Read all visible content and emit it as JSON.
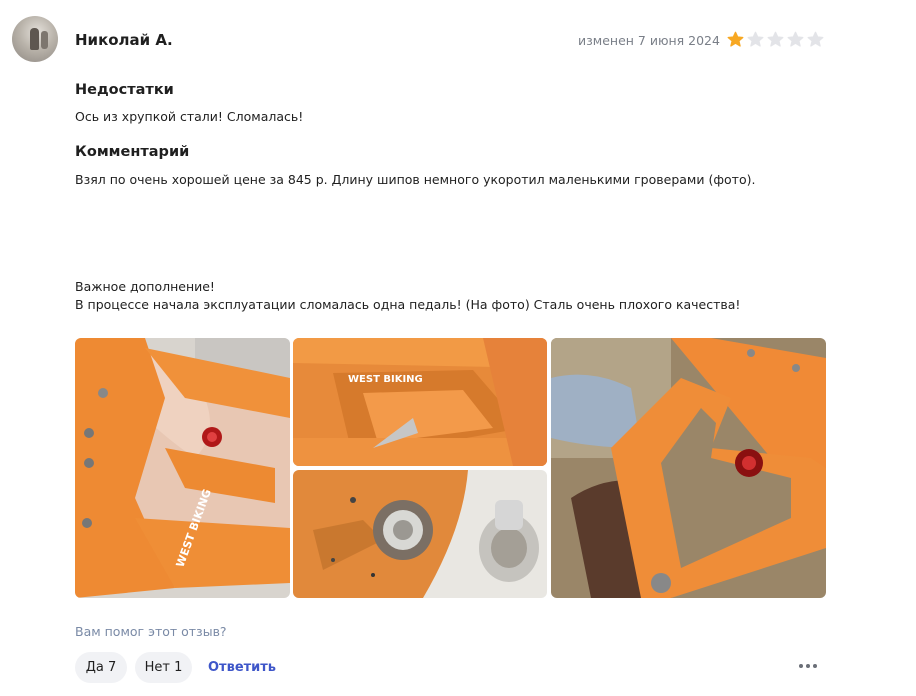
{
  "review": {
    "author": "Николай А.",
    "edited": "изменен 7 июня 2024",
    "rating": 1,
    "rating_max": 5,
    "colors": {
      "star_on": "#f7a823",
      "star_off": "#e3e4e8"
    },
    "cons_title": "Недостатки",
    "cons_text": "Ось из хрупкой стали! Сломалась!",
    "comment_title": "Комментарий",
    "comment_text": "Взял по очень хорошей цене за 845 р. Длину шипов немного укоротил маленькими гроверами (фото).",
    "addition_line1": "Важное дополнение!",
    "addition_line2": "В процессе начала эксплуатации сломалась одна педаль! (На фото) Сталь очень плохого качества!",
    "photos": [
      {
        "name": "pedal-in-hand",
        "label": "WEST BIKING"
      },
      {
        "name": "pedal-closeup-logo",
        "label": "WEST BIKING"
      },
      {
        "name": "broken-axle"
      },
      {
        "name": "pedal-on-table"
      }
    ]
  },
  "footer": {
    "helpful_question": "Вам помог этот отзыв?",
    "yes_label": "Да 7",
    "no_label": "Нет 1",
    "reply_label": "Ответить",
    "more_icon": "more-dots-icon"
  }
}
